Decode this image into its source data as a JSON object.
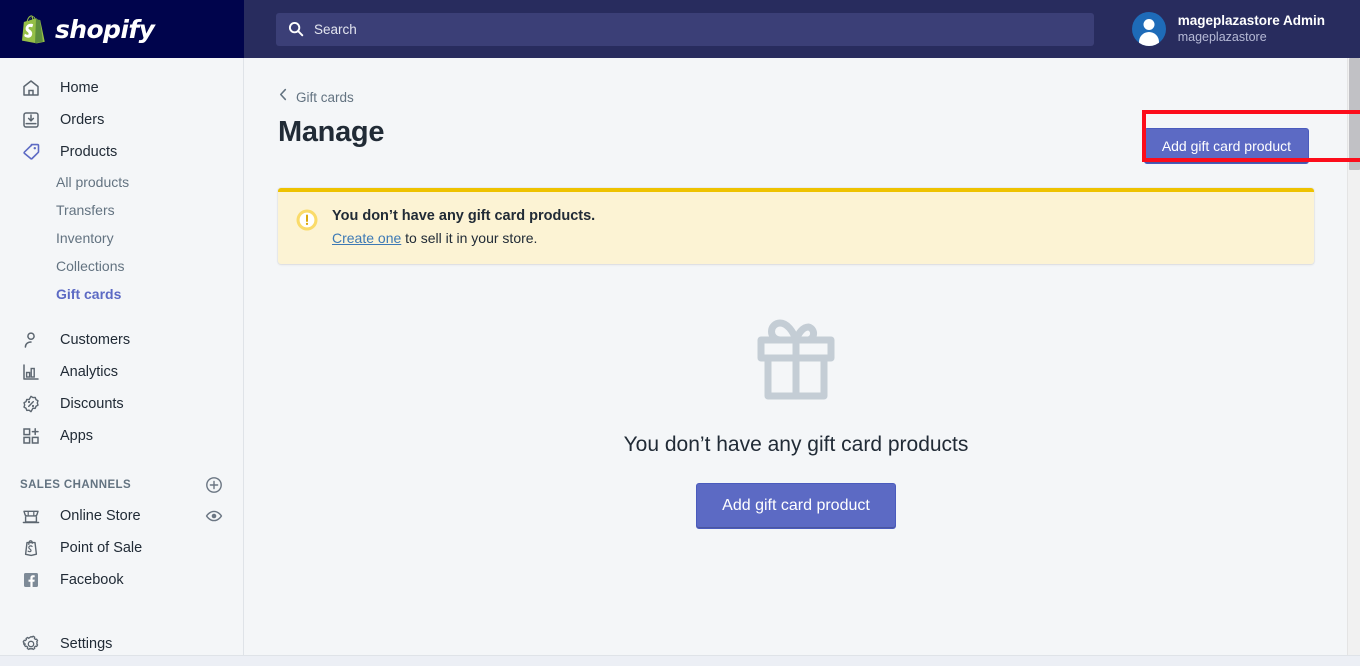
{
  "topbar": {
    "brand": "shopify",
    "brand_icon": "shopify-bag-logo",
    "search": {
      "icon": "search-icon",
      "placeholder": "Search",
      "value": ""
    },
    "user": {
      "avatar_icon": "user-avatar-icon",
      "name": "mageplazastore Admin",
      "store": "mageplazastore"
    }
  },
  "sidebar": {
    "items": [
      {
        "label": "Home",
        "icon": "home-icon",
        "active": false
      },
      {
        "label": "Orders",
        "icon": "orders-inbox-icon",
        "active": false
      },
      {
        "label": "Products",
        "icon": "products-tag-icon",
        "active": true
      }
    ],
    "sub_items": [
      {
        "label": "All products",
        "active": false
      },
      {
        "label": "Transfers",
        "active": false
      },
      {
        "label": "Inventory",
        "active": false
      },
      {
        "label": "Collections",
        "active": false
      },
      {
        "label": "Gift cards",
        "active": true
      }
    ],
    "items_after": [
      {
        "label": "Customers",
        "icon": "customers-person-icon",
        "active": false
      },
      {
        "label": "Analytics",
        "icon": "analytics-bars-icon",
        "active": false
      },
      {
        "label": "Discounts",
        "icon": "discounts-percent-icon",
        "active": false
      },
      {
        "label": "Apps",
        "icon": "apps-grid-plus-icon",
        "active": false
      }
    ],
    "section": {
      "title": "SALES CHANNELS",
      "add_icon": "plus-circle-icon"
    },
    "channels": [
      {
        "label": "Online Store",
        "icon": "online-store-icon",
        "action_icon": "eye-icon"
      },
      {
        "label": "Point of Sale",
        "icon": "point-of-sale-icon",
        "action_icon": ""
      },
      {
        "label": "Facebook",
        "icon": "facebook-icon",
        "action_icon": ""
      }
    ],
    "settings": {
      "label": "Settings",
      "icon": "gear-icon"
    }
  },
  "main": {
    "breadcrumb": {
      "icon": "chevron-left-icon",
      "label": "Gift cards"
    },
    "title": "Manage",
    "header_button": "Add gift card product",
    "banner": {
      "icon": "warning-circle-icon",
      "title": "You don’t have any gift card products.",
      "link": "Create one",
      "body_rest": " to sell it in your store."
    },
    "empty_state": {
      "icon": "gift-box-icon",
      "title": "You don’t have any gift card products",
      "button": "Add gift card product"
    }
  },
  "colors": {
    "brand_navy": "#00044c",
    "topbar": "#282c5e",
    "accent_indigo": "#5c6ac4",
    "banner_bg": "#fcf3d4",
    "banner_border": "#eec200",
    "annotation_red": "#fc0d1b",
    "page_bg": "#f4f6f8"
  }
}
